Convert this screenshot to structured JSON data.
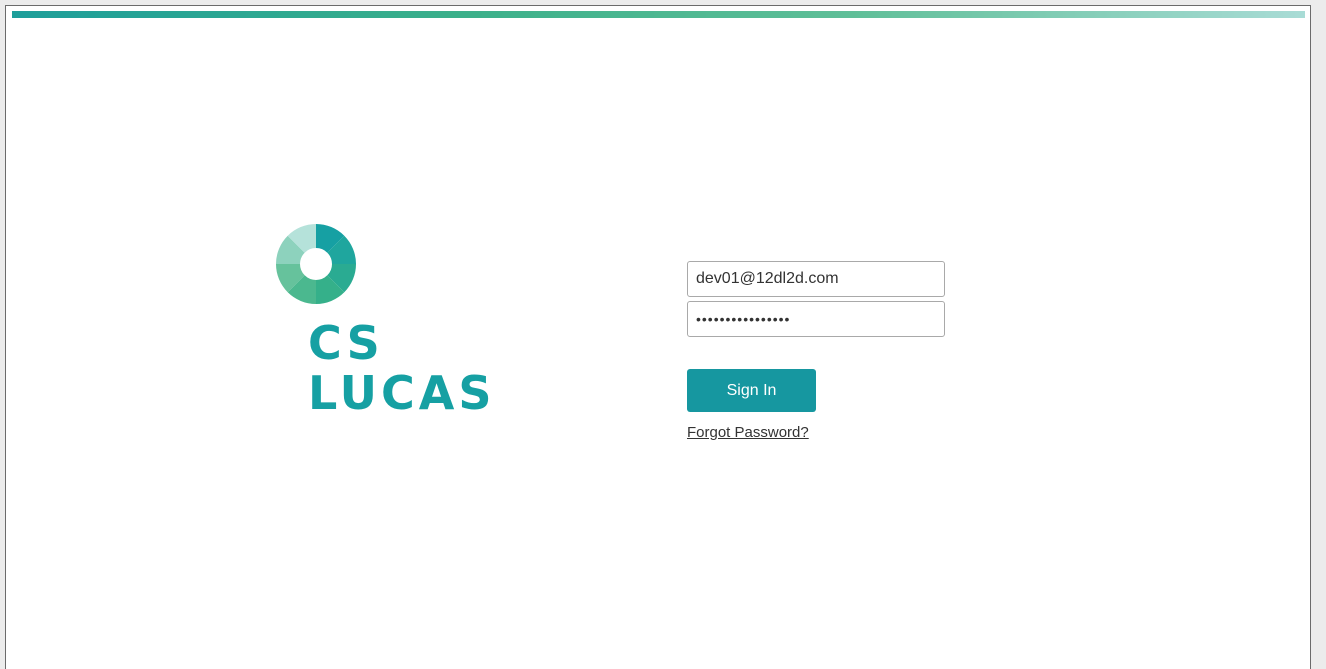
{
  "brand": {
    "logo_icon": "donut-logo-icon",
    "name_line1": "CS",
    "name_line2": "LUCAS",
    "colors": {
      "primary": "#16a0a3",
      "accent_green": "#3bb08a",
      "accent_light": "#a9dcd6"
    }
  },
  "login": {
    "email_value": "dev01@12dl2d.com",
    "password_value": "••••••••••••••••",
    "signin_label": "Sign In",
    "forgot_label": "Forgot Password?"
  }
}
